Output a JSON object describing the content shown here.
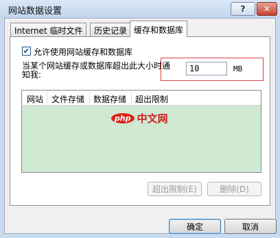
{
  "window": {
    "title": "网站数据设置",
    "help_label": "?",
    "close_label": "✕"
  },
  "tabs": [
    {
      "label": "Internet 临时文件",
      "active": false
    },
    {
      "label": "历史记录",
      "active": false
    },
    {
      "label": "缓存和数据库",
      "active": true
    }
  ],
  "settings": {
    "allow_label": "允许使用网站缓存和数据库",
    "allow_checked": true,
    "size_label": "当某个网站缓存或数据库超出此大小时通知我:",
    "size_value": "10",
    "size_unit": "MB"
  },
  "site_list": {
    "columns": [
      "网站",
      "文件存储",
      "数据存储",
      "超出限制"
    ],
    "rows": []
  },
  "watermark": {
    "logo": "php",
    "text": "中文网"
  },
  "panel_buttons": {
    "clear_limit": "超出限制(E)",
    "delete": "删除(D)"
  },
  "dialog_buttons": {
    "ok": "确定",
    "cancel": "取消"
  },
  "colors": {
    "highlight_box": "#e03c3c",
    "list_background": "#cfe9d3"
  }
}
